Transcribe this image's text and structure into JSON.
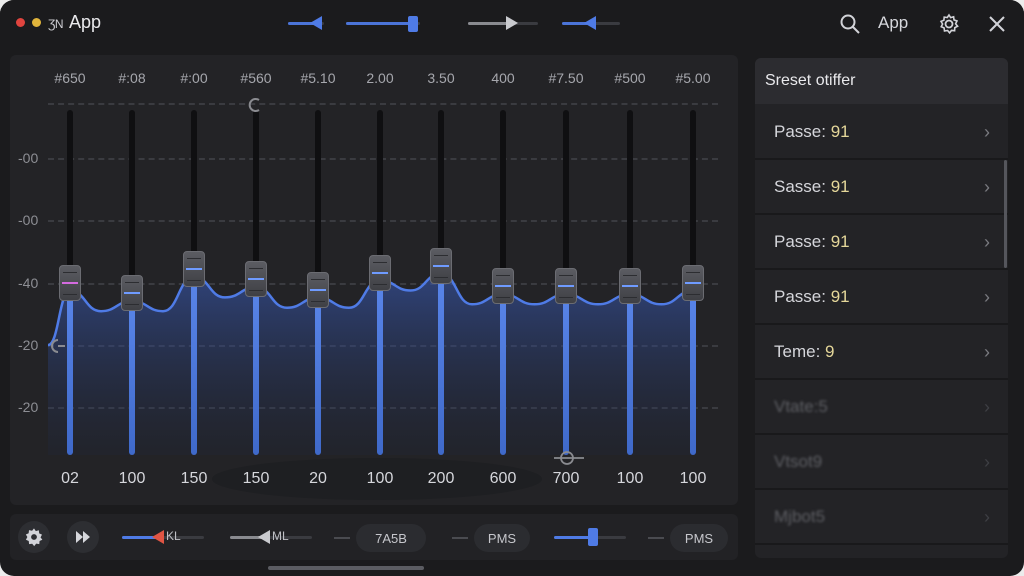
{
  "window": {
    "title": "App",
    "title_badge": "ƷN",
    "traffic_colors": [
      "#e0443e",
      "#e0b43b"
    ]
  },
  "header": {
    "app_label": "App",
    "icons": [
      "search-icon",
      "gear-icon",
      "close-icon"
    ],
    "sliders": [
      {
        "name": "header-slider-1",
        "fill": 0.65
      },
      {
        "name": "header-slider-2",
        "fill": 0.85
      },
      {
        "name": "header-slider-3",
        "fill": 0.8
      },
      {
        "name": "header-slider-4",
        "fill": 0.5
      }
    ]
  },
  "eq": {
    "gain_labels": [
      "-00",
      "-00",
      "-40",
      "-20",
      "-20"
    ],
    "bands": [
      {
        "top": "#650",
        "bottom": "02",
        "level": 0.47,
        "accent": "pink"
      },
      {
        "top": "#:08",
        "bottom": "100",
        "level": 0.44,
        "accent": "blue"
      },
      {
        "top": "#:00",
        "bottom": "150",
        "level": 0.51,
        "accent": "blue"
      },
      {
        "top": "#560",
        "bottom": "150",
        "level": 0.48,
        "accent": "blue"
      },
      {
        "top": "#5.10",
        "bottom": "20",
        "level": 0.45,
        "accent": "blue"
      },
      {
        "top": "2.00",
        "bottom": "100",
        "level": 0.5,
        "accent": "blue"
      },
      {
        "top": "3.50",
        "bottom": "200",
        "level": 0.52,
        "accent": "blue"
      },
      {
        "top": "400",
        "bottom": "600",
        "level": 0.46,
        "accent": "blue"
      },
      {
        "top": "#7.50",
        "bottom": "700",
        "level": 0.46,
        "accent": "blue"
      },
      {
        "top": "#500",
        "bottom": "100",
        "level": 0.46,
        "accent": "blue"
      },
      {
        "top": "#5.00",
        "bottom": "100",
        "level": 0.47,
        "accent": "blue"
      }
    ],
    "accent_color": "#4f7be6"
  },
  "preset": {
    "title": "Sreset otiffer",
    "items": [
      {
        "name": "Passe:",
        "value": "91",
        "faded": false
      },
      {
        "name": "Sasse:",
        "value": "91",
        "faded": false
      },
      {
        "name": "Passe:",
        "value": "91",
        "faded": false
      },
      {
        "name": "Passe:",
        "value": "91",
        "faded": false
      },
      {
        "name": "Teme:",
        "value": "9",
        "faded": false
      },
      {
        "name": "Vtate:5",
        "value": "",
        "faded": true
      },
      {
        "name": "Vtsot9",
        "value": "",
        "faded": true
      },
      {
        "name": "Mjbot5",
        "value": "",
        "faded": true
      }
    ]
  },
  "bottom": {
    "slider1_text": "KL",
    "slider2_text": "ML",
    "pill1": "7A5B",
    "pill2": "PMS",
    "pill3": "PMS",
    "slider1_fill": 0.55,
    "slider2_fill": 0.55,
    "slider3_fill": 0.55,
    "slider1_color": "#e05544",
    "slider3_color": "#4f7be6"
  }
}
